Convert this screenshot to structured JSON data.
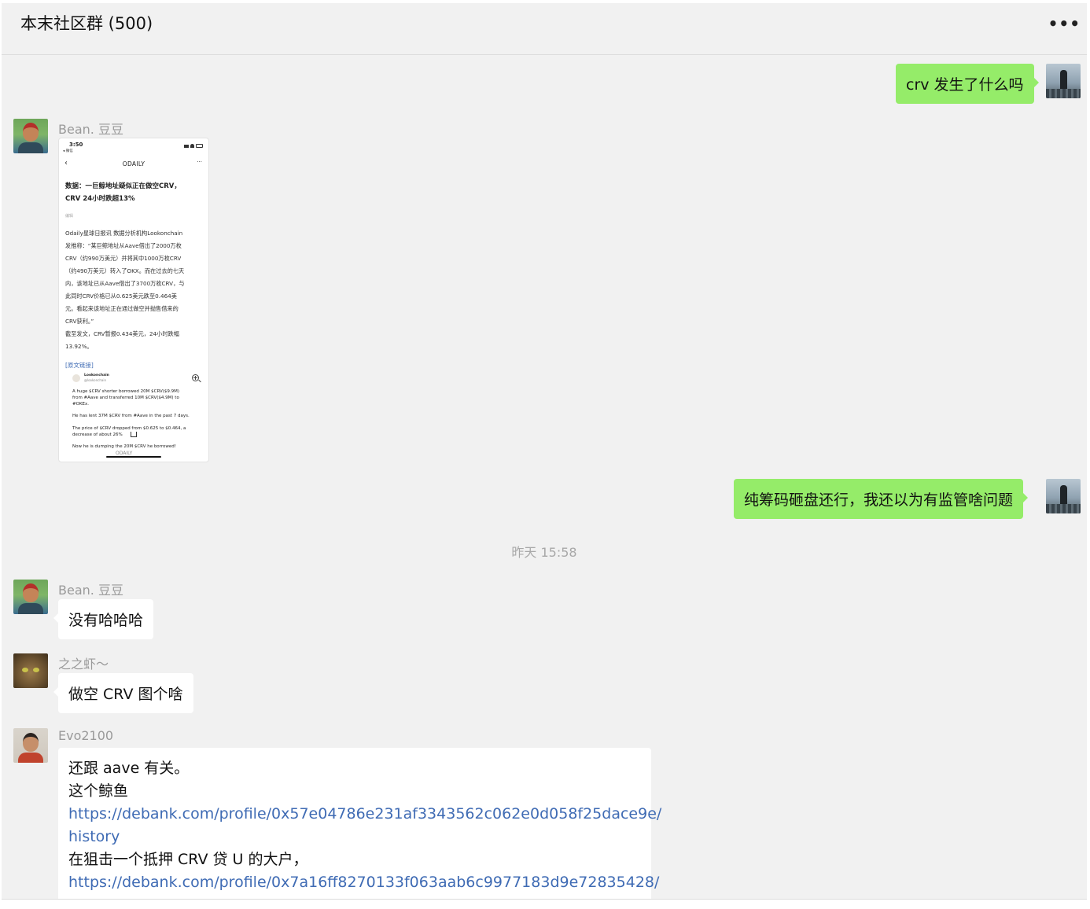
{
  "header": {
    "title": "本末社区群 (500)",
    "more_label": "•••"
  },
  "messages": {
    "m1": {
      "text": "crv 发生了什么吗"
    },
    "m2": {
      "sender": "Bean. 豆豆",
      "screenshot": {
        "status_time": "3:50",
        "status_back": "◂ 微信",
        "nav_title": "ODAILY",
        "headline_1": "数据：一巨鲸地址疑似正在做空CRV，",
        "headline_2": "CRV 24小时跌超13%",
        "source_tag": "编辑",
        "body_lines": [
          "Odaily星球日报讯 数据分析机构Lookonchain",
          "发推称：“某巨鲸地址从Aave借出了2000万枚",
          "CRV（约990万美元）并将其中1000万枚CRV",
          "（约490万美元）转入了OKX。而在过去的七天",
          "内，该地址已从Aave借出了3700万枚CRV，与",
          "此同时CRV价格已从0.625美元跌至0.464美",
          "元。看起来该地址正在通过做空并抛售借来的",
          "CRV获利。”",
          "截至发文，CRV暂报0.434美元，24小时跌幅",
          "13.92%。"
        ],
        "link_label": "[原文链接]",
        "tweet_author": "Lookonchain",
        "tweet_handle": "@lookonchain",
        "tweet_lines": [
          "A huge $CRV shorter borrowed 20M $CRV($9.9M)",
          "from #Aave and transferred 10M $CRV($4.9M) to",
          "#OKEx.",
          "",
          "He has lent 37M $CRV from #Aave in the past 7 days.",
          "",
          "The price of $CRV dropped from $0.625 to $0.464, a",
          "decrease of about 26%",
          "",
          "Now he is dumping the 20M $CRV he borrowed!"
        ],
        "footer_brand": "ODAILY"
      }
    },
    "m3": {
      "text": "纯筹码砸盘还行，我还以为有监管啥问题"
    },
    "timestamp": "昨天 15:58",
    "m4": {
      "sender": "Bean. 豆豆",
      "text": "没有哈哈哈"
    },
    "m5": {
      "sender": "之之虾～",
      "text": "做空 CRV 图个啥"
    },
    "m6": {
      "sender": "Evo2100",
      "lines": [
        "还跟 aave 有关。",
        "这个鲸鱼",
        "https://debank.com/profile/0x57e04786e231af3343562c062e0d058f25dace9e/",
        "history",
        "在狙击一个抵押 CRV 贷 U 的大户，",
        "https://debank.com/profile/0x7a16ff8270133f063aab6c9977183d9e72835428/"
      ]
    }
  },
  "icons": {
    "more": "more-horizontal-icon",
    "back": "chevron-left-icon",
    "zoom": "zoom-in-icon",
    "share": "share-icon"
  },
  "colors": {
    "chat_background": "#f1f1f1",
    "outgoing_bubble": "#95ec69",
    "incoming_bubble": "#ffffff",
    "link": "#3f6bb4",
    "sender_name": "#9a9a9a"
  }
}
